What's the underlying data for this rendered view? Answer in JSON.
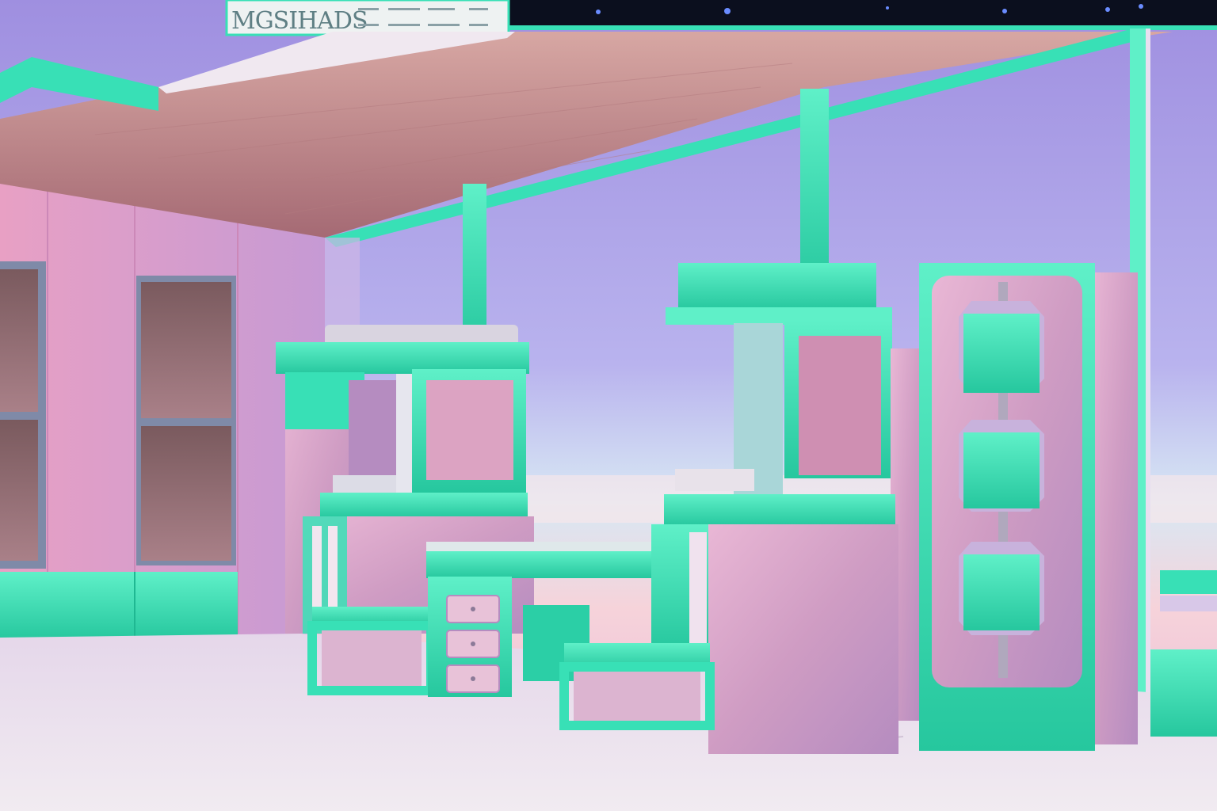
{
  "sign": {
    "title": "MGSIHADS"
  },
  "colors": {
    "mint": "#38e0b6",
    "mint_dark": "#1fb892",
    "pink_wall": "#e8a0c4",
    "lavender_sky": "#b79fe2",
    "ceiling_wood": "#c98f8b",
    "floor": "#e8dce9",
    "metal_pink": "#d9a6c6",
    "night_strip": "#0b0f1e"
  }
}
